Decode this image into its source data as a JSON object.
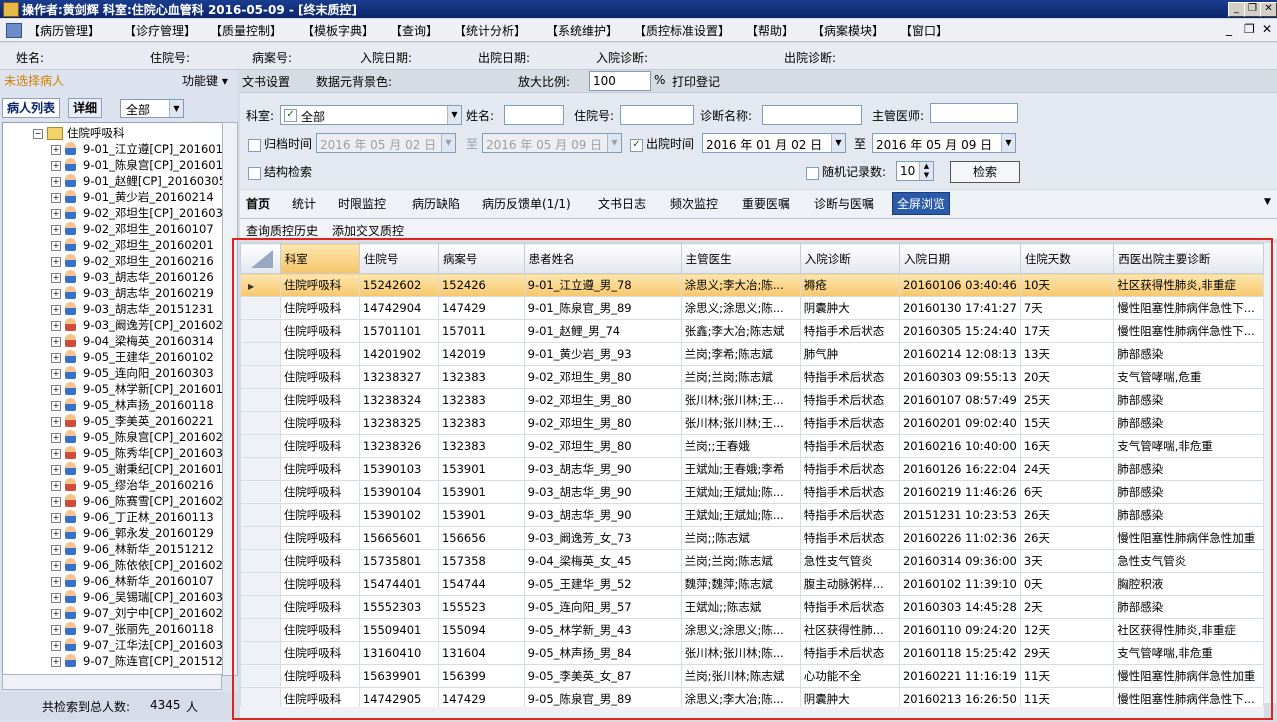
{
  "titlebar": {
    "title": "操作者:黄剑辉   科室:住院心血管科   2016-05-09 - [终末质控]"
  },
  "menu": {
    "items": [
      "【病历管理】",
      "【诊疗管理】",
      "【质量控制】",
      "【模板字典】",
      "【查询】",
      "【统计分析】",
      "【系统维护】",
      "【质控标准设置】",
      "【帮助】",
      "【病案模块】",
      "【窗口】"
    ]
  },
  "infobar": {
    "labels": [
      "姓名:",
      "住院号:",
      "病案号:",
      "入院日期:",
      "出院日期:",
      "入院诊断:",
      "出院诊断:"
    ]
  },
  "left": {
    "no_patient": "未选择病人",
    "func_key": "功能键",
    "tab_list": "病人列表",
    "tab_detail": "详细",
    "filter_value": "全部",
    "tree_root": "住院呼吸科",
    "patients": [
      {
        "name": "9-01_江立遵[CP]_201601",
        "g": "m"
      },
      {
        "name": "9-01_陈泉宫[CP]_201601",
        "g": "m"
      },
      {
        "name": "9-01_赵鲤[CP]_20160305",
        "g": "m"
      },
      {
        "name": "9-01_黄少岩_20160214",
        "g": "m"
      },
      {
        "name": "9-02_邓坦生[CP]_201603",
        "g": "m"
      },
      {
        "name": "9-02_邓坦生_20160107",
        "g": "m"
      },
      {
        "name": "9-02_邓坦生_20160201",
        "g": "m"
      },
      {
        "name": "9-02_邓坦生_20160216",
        "g": "m"
      },
      {
        "name": "9-03_胡志华_20160126",
        "g": "m"
      },
      {
        "name": "9-03_胡志华_20160219",
        "g": "m"
      },
      {
        "name": "9-03_胡志华_20151231",
        "g": "m"
      },
      {
        "name": "9-03_阚逸芳[CP]_201602",
        "g": "f"
      },
      {
        "name": "9-04_梁梅英_20160314",
        "g": "f"
      },
      {
        "name": "9-05_王建华_20160102",
        "g": "m"
      },
      {
        "name": "9-05_连向阳_20160303",
        "g": "m"
      },
      {
        "name": "9-05_林学新[CP]_201601",
        "g": "m"
      },
      {
        "name": "9-05_林声扬_20160118",
        "g": "m"
      },
      {
        "name": "9-05_李美英_20160221",
        "g": "f"
      },
      {
        "name": "9-05_陈泉宫[CP]_201602",
        "g": "m"
      },
      {
        "name": "9-05_陈秀华[CP]_201603",
        "g": "f"
      },
      {
        "name": "9-05_谢秉纪[CP]_201601",
        "g": "m"
      },
      {
        "name": "9-05_缪治华_20160216",
        "g": "f"
      },
      {
        "name": "9-06_陈赛雪[CP]_201602",
        "g": "f"
      },
      {
        "name": "9-06_丁正林_20160113",
        "g": "m"
      },
      {
        "name": "9-06_郭永发_20160129",
        "g": "m"
      },
      {
        "name": "9-06_林新华_20151212",
        "g": "m"
      },
      {
        "name": "9-06_陈依依[CP]_201602",
        "g": "m"
      },
      {
        "name": "9-06_林新华_20160107",
        "g": "m"
      },
      {
        "name": "9-06_吴锡瑞[CP]_201603",
        "g": "m"
      },
      {
        "name": "9-07_刘宁中[CP]_201602",
        "g": "m"
      },
      {
        "name": "9-07_张丽先_20160118",
        "g": "m"
      },
      {
        "name": "9-07_江华法[CP]_201603",
        "g": "m"
      },
      {
        "name": "9-07_陈连官[CP]_201512",
        "g": "m"
      }
    ],
    "total_label": "共检索到总人数:",
    "total_count": "4345",
    "total_unit": "人"
  },
  "toolbar": {
    "doc_settings": "文书设置",
    "data_bg": "数据元背景色:",
    "zoom_label": "放大比例:",
    "zoom_value": "100",
    "zoom_unit": "%",
    "print_reg": "打印登记"
  },
  "search": {
    "dept_label": "科室:",
    "dept_value": "全部",
    "name_label": "姓名:",
    "inpatient_label": "住院号:",
    "diag_label": "诊断名称:",
    "doctor_label": "主管医师:",
    "archive_label": "归档时间",
    "archive_from": "2016 年 05 月 02 日",
    "archive_to": "2016 年 05 月 09 日",
    "to": "至",
    "discharge_label": "出院时间",
    "discharge_from": "2016 年 01 月 02 日",
    "discharge_to": "2016 年 05 月 09 日",
    "struct_search": "结构检索",
    "random_label": "随机记录数:",
    "random_value": "10",
    "search_button": "检索"
  },
  "tabs": [
    "首页",
    "统计",
    "时限监控",
    "病历缺陷",
    "病历反馈单(1/1)",
    "文书日志",
    "频次监控",
    "重要医嘱",
    "诊断与医嘱",
    "全屏浏览"
  ],
  "subtabs": [
    "查询质控历史",
    "添加交叉质控"
  ],
  "grid": {
    "headers": [
      "科室",
      "住院号",
      "病案号",
      "患者姓名",
      "主管医生",
      "入院诊断",
      "入院日期",
      "住院天数",
      "西医出院主要诊断"
    ],
    "rows": [
      [
        "住院呼吸科",
        "15242602",
        "152426",
        "9-01_江立遵_男_78",
        "涂思义;李大冶;陈...",
        "褥疮",
        "20160106 03:40:46",
        "10天",
        "社区获得性肺炎,非重症"
      ],
      [
        "住院呼吸科",
        "14742904",
        "147429",
        "9-01_陈泉官_男_89",
        "涂思义;涂思义;陈...",
        "阴囊肿大",
        "20160130 17:41:27",
        "7天",
        "慢性阻塞性肺病伴急性下..."
      ],
      [
        "住院呼吸科",
        "15701101",
        "157011",
        "9-01_赵鲤_男_74",
        "张鑫;李大冶;陈志斌",
        "特指手术后状态",
        "20160305 15:24:40",
        "17天",
        "慢性阻塞性肺病伴急性下..."
      ],
      [
        "住院呼吸科",
        "14201902",
        "142019",
        "9-01_黄少岩_男_93",
        "兰岗;李希;陈志斌",
        "肺气肿",
        "20160214 12:08:13",
        "13天",
        "肺部感染"
      ],
      [
        "住院呼吸科",
        "13238327",
        "132383",
        "9-02_邓坦生_男_80",
        "兰岗;兰岗;陈志斌",
        "特指手术后状态",
        "20160303 09:55:13",
        "20天",
        "支气管哮喘,危重"
      ],
      [
        "住院呼吸科",
        "13238324",
        "132383",
        "9-02_邓坦生_男_80",
        "张川林;张川林;王...",
        "特指手术后状态",
        "20160107 08:57:49",
        "25天",
        "肺部感染"
      ],
      [
        "住院呼吸科",
        "13238325",
        "132383",
        "9-02_邓坦生_男_80",
        "张川林;张川林;王...",
        "特指手术后状态",
        "20160201 09:02:40",
        "15天",
        "肺部感染"
      ],
      [
        "住院呼吸科",
        "13238326",
        "132383",
        "9-02_邓坦生_男_80",
        "兰岗;;王春娥",
        "特指手术后状态",
        "20160216 10:40:00",
        "16天",
        "支气管哮喘,非危重"
      ],
      [
        "住院呼吸科",
        "15390103",
        "153901",
        "9-03_胡志华_男_90",
        "王斌灿;王春娥;李希",
        "特指手术后状态",
        "20160126 16:22:04",
        "24天",
        "肺部感染"
      ],
      [
        "住院呼吸科",
        "15390104",
        "153901",
        "9-03_胡志华_男_90",
        "王斌灿;王斌灿;陈...",
        "特指手术后状态",
        "20160219 11:46:26",
        "6天",
        "肺部感染"
      ],
      [
        "住院呼吸科",
        "15390102",
        "153901",
        "9-03_胡志华_男_90",
        "王斌灿;王斌灿;陈...",
        "特指手术后状态",
        "20151231 10:23:53",
        "26天",
        "肺部感染"
      ],
      [
        "住院呼吸科",
        "15665601",
        "156656",
        "9-03_阚逸芳_女_73",
        "兰岗;;陈志斌",
        "特指手术后状态",
        "20160226 11:02:36",
        "26天",
        "慢性阻塞性肺病伴急性加重"
      ],
      [
        "住院呼吸科",
        "15735801",
        "157358",
        "9-04_梁梅英_女_45",
        "兰岗;兰岗;陈志斌",
        "急性支气管炎",
        "20160314 09:36:00",
        "3天",
        "急性支气管炎"
      ],
      [
        "住院呼吸科",
        "15474401",
        "154744",
        "9-05_王建华_男_52",
        "魏萍;魏萍;陈志斌",
        "腹主动脉粥样...",
        "20160102 11:39:10",
        "0天",
        "胸腔积液"
      ],
      [
        "住院呼吸科",
        "15552303",
        "155523",
        "9-05_连向阳_男_57",
        "王斌灿;;陈志斌",
        "特指手术后状态",
        "20160303 14:45:28",
        "2天",
        "肺部感染"
      ],
      [
        "住院呼吸科",
        "15509401",
        "155094",
        "9-05_林学新_男_43",
        "涂思义;涂思义;陈...",
        "社区获得性肺...",
        "20160110 09:24:20",
        "12天",
        "社区获得性肺炎,非重症"
      ],
      [
        "住院呼吸科",
        "13160410",
        "131604",
        "9-05_林声扬_男_84",
        "张川林;张川林;陈...",
        "特指手术后状态",
        "20160118 15:25:42",
        "29天",
        "支气管哮喘,非危重"
      ],
      [
        "住院呼吸科",
        "15639901",
        "156399",
        "9-05_李美英_女_87",
        "兰岗;张川林;陈志斌",
        "心功能不全",
        "20160221 11:16:19",
        "11天",
        "慢性阻塞性肺病伴急性加重"
      ],
      [
        "住院呼吸科",
        "14742905",
        "147429",
        "9-05_陈泉官_男_89",
        "涂思义;李大冶;陈...",
        "阴囊肿大",
        "20160213 16:26:50",
        "11天",
        "慢性阻塞性肺病伴急性下..."
      ]
    ]
  }
}
